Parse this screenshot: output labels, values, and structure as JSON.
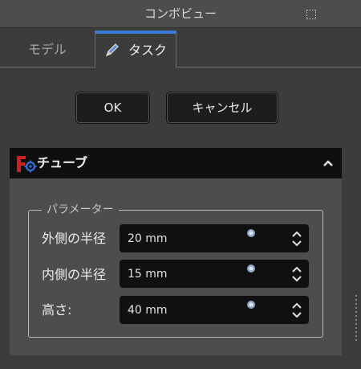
{
  "window": {
    "title": "コンボビュー"
  },
  "tabs": [
    {
      "label": "モデル"
    },
    {
      "label": "タスク"
    }
  ],
  "buttons": {
    "ok": "OK",
    "cancel": "キャンセル"
  },
  "panel": {
    "title": "チューブ",
    "group_title": "パラメーター",
    "fields": [
      {
        "label": "外側の半径",
        "value": "20 mm"
      },
      {
        "label": "内側の半径",
        "value": "15 mm"
      },
      {
        "label": "高さ:",
        "value": "40 mm"
      }
    ]
  },
  "colors": {
    "accent": "#3c7cd6",
    "logo_red": "#d11f1f",
    "logo_blue": "#2f6bd1"
  },
  "icons": [
    "float-icon",
    "pencil-icon",
    "freecad-gear-icon",
    "chevron-up-icon",
    "expression-icon",
    "spinbox-arrows-icon"
  ]
}
